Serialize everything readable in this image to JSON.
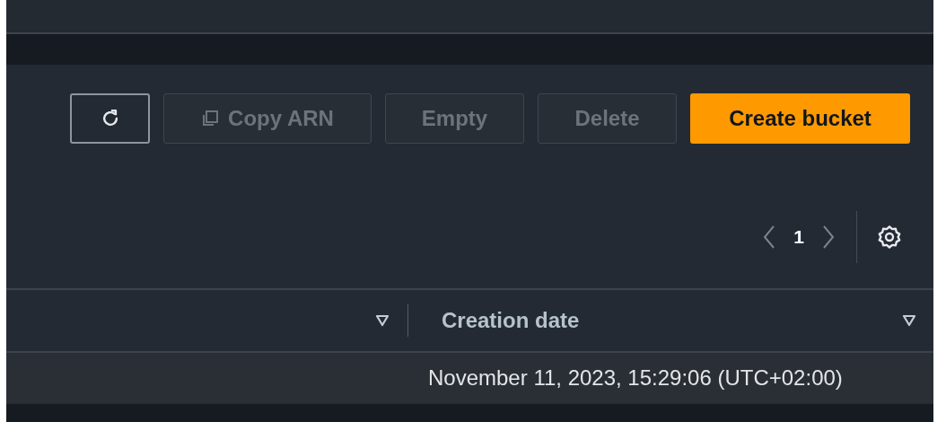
{
  "actions": [
    {
      "kind": "refresh",
      "disabled": false
    },
    {
      "kind": "copy",
      "label": "Copy ARN",
      "disabled": true
    },
    {
      "kind": "text",
      "label": "Empty",
      "disabled": true
    },
    {
      "kind": "text",
      "label": "Delete",
      "disabled": true
    },
    {
      "kind": "primary",
      "label": "Create bucket",
      "disabled": false
    }
  ],
  "pagination": {
    "page": "1",
    "prev_disabled": true,
    "next_disabled": true
  },
  "table": {
    "columns": [
      {
        "sortable": true
      },
      {
        "label": "Creation date",
        "sortable": true
      }
    ],
    "rows": [
      {
        "column_2": "November 11, 2023, 15:29:06 (UTC+02:00)"
      }
    ]
  }
}
